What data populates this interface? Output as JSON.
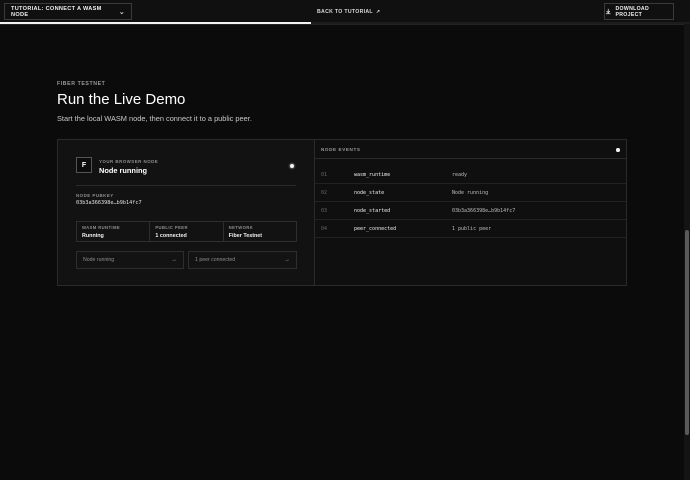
{
  "topbar": {
    "tutorial_select": "TUTORIAL: CONNECT A WASM NODE",
    "back_link": "BACK TO TUTORIAL",
    "download_button": "DOWNLOAD PROJECT",
    "progress_fraction": 0.45
  },
  "header": {
    "eyebrow": "FIBER TESTNET",
    "title": "Run the Live Demo",
    "subtitle": "Start the local WASM node, then connect it to a public peer."
  },
  "node": {
    "kicker": "YOUR BROWSER NODE",
    "avatar_letter": "F",
    "status": "Node running",
    "pubkey_label": "NODE PUBKEY",
    "pubkey_value": "03b3a366398e…b9b14fc7",
    "stats": [
      {
        "label": "WASM RUNTIME",
        "value": "Running"
      },
      {
        "label": "PUBLIC PEER",
        "value": "1 connected"
      },
      {
        "label": "NETWORK",
        "value": "Fiber Testnet"
      }
    ],
    "actions": [
      {
        "label": "Node running"
      },
      {
        "label": "1 peer connected"
      }
    ]
  },
  "events": {
    "title": "NODE EVENTS",
    "rows": [
      {
        "num": "01",
        "key": "wasm_runtime",
        "value": "ready"
      },
      {
        "num": "02",
        "key": "node_state",
        "value": "Node running"
      },
      {
        "num": "03",
        "key": "node_started",
        "value": "03b3a366398e…b9b14fc7"
      },
      {
        "num": "04",
        "key": "peer_connected",
        "value": "1 public peer"
      }
    ]
  },
  "icons": {
    "chevron": "chevron-down-icon",
    "arrow": "arrow-up-right-icon",
    "download": "download-icon",
    "action_arrow": "arrow-right-icon"
  }
}
